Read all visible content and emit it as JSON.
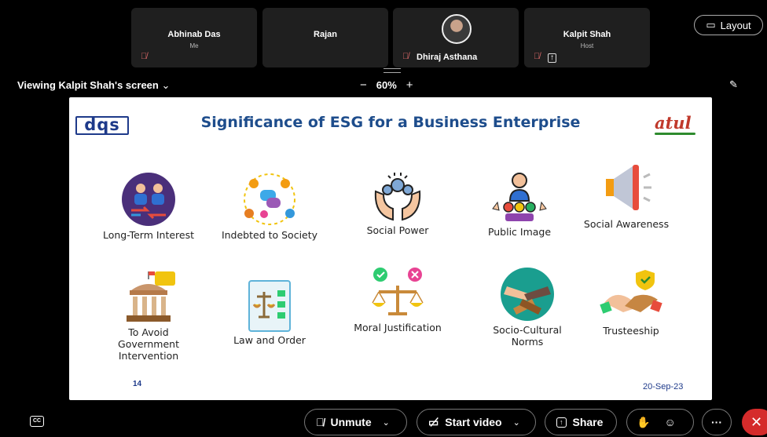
{
  "participants": [
    {
      "name": "Abhinab Das",
      "sub": "Me",
      "muted": true
    },
    {
      "name": "Rajan",
      "sub": "",
      "muted": false
    },
    {
      "name": "Dhiraj Asthana",
      "sub": "",
      "muted": true
    },
    {
      "name": "Kalpit Shah",
      "sub": "Host",
      "muted": true
    }
  ],
  "layout_label": "Layout",
  "viewing_label": "Viewing Kalpit Shah's screen",
  "zoom": {
    "minus": "−",
    "value": "60%",
    "plus": "+"
  },
  "slide": {
    "title": "Significance of ESG for a Business Enterprise",
    "left_logo": "dqs",
    "right_logo": "atul",
    "page_number": "14",
    "date": "20-Sep-23",
    "items": [
      {
        "label": "Long-Term Interest",
        "icon": "people-exchange-icon"
      },
      {
        "label": "Indebted to Society",
        "icon": "community-chat-icon"
      },
      {
        "label": "Social Power",
        "icon": "hands-group-icon"
      },
      {
        "label": "Public Image",
        "icon": "speaker-audience-icon"
      },
      {
        "label": "Social Awareness",
        "icon": "megaphone-icon"
      },
      {
        "label": "To Avoid Government Intervention",
        "icon": "government-building-icon"
      },
      {
        "label": "Law and Order",
        "icon": "scales-checklist-icon"
      },
      {
        "label": "Moral Justification",
        "icon": "balance-scale-icon"
      },
      {
        "label": "Socio-Cultural Norms",
        "icon": "stacked-hands-icon"
      },
      {
        "label": "Trusteeship",
        "icon": "handshake-shield-icon"
      }
    ]
  },
  "toolbar": {
    "unmute": "Unmute",
    "start_video": "Start video",
    "share": "Share",
    "more": "···"
  },
  "colors": {
    "accent": "#1e4d8c",
    "end_call": "#d52b2b",
    "atul_red": "#c0392b",
    "atul_green": "#2e8b2e"
  }
}
